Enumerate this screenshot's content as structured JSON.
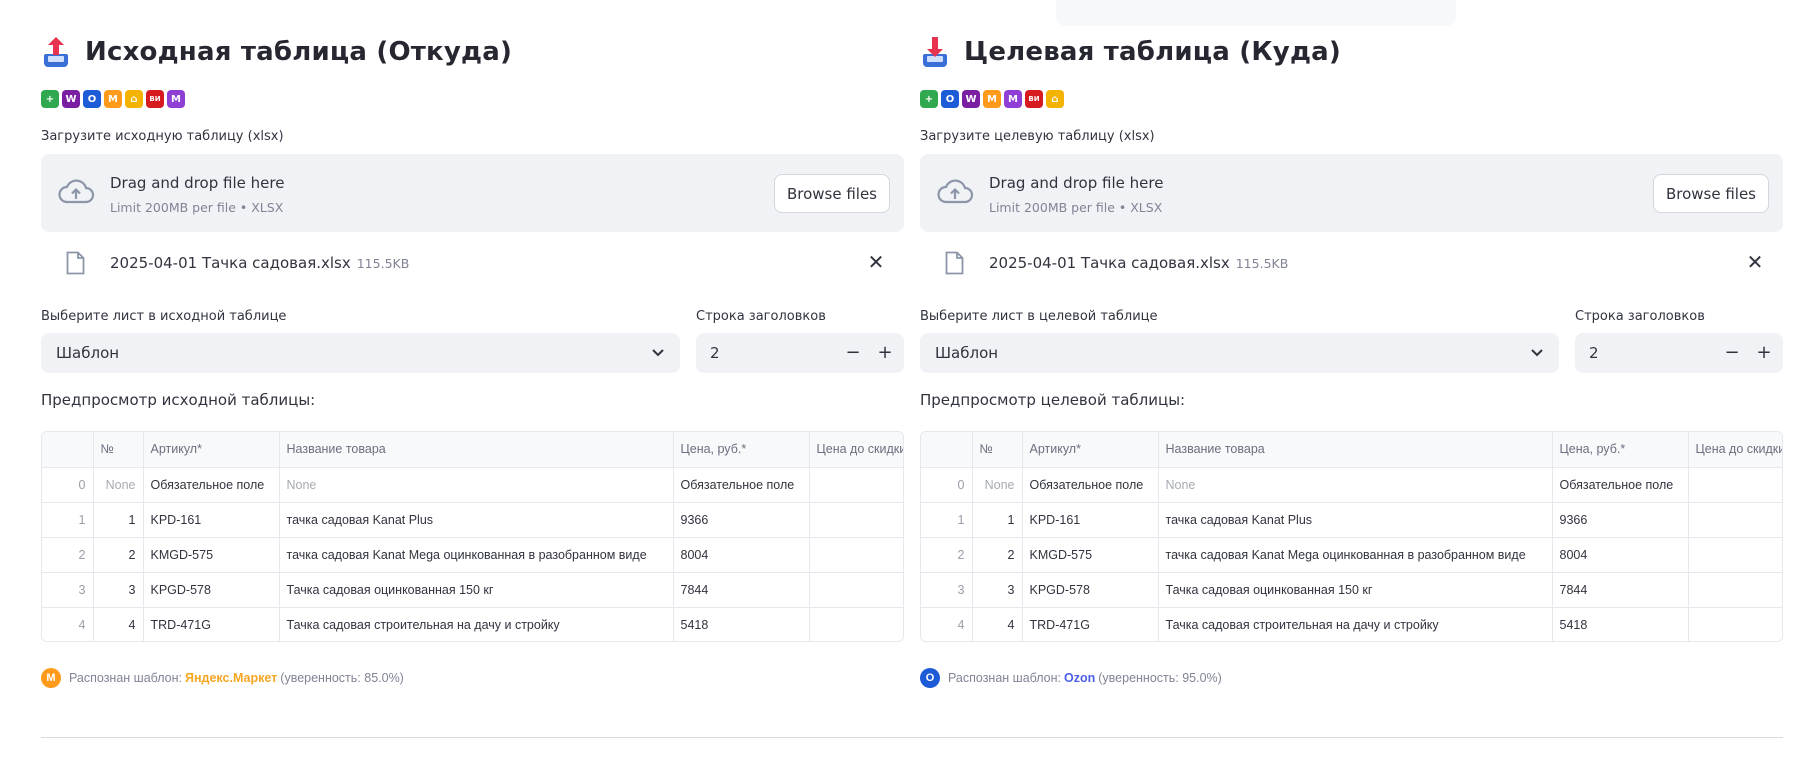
{
  "marketplace_icons_left": [
    {
      "name": "plus-icon",
      "glyph": "+",
      "color": "#2fa84f"
    },
    {
      "name": "wildberries-icon",
      "glyph": "W",
      "color": "#7b1fa2"
    },
    {
      "name": "ozon-icon",
      "glyph": "O",
      "color": "#1e5bd6"
    },
    {
      "name": "yandex-market-icon",
      "glyph": "M",
      "color": "#ff9a1a"
    },
    {
      "name": "home-icon",
      "glyph": "⌂",
      "color": "#f5b301"
    },
    {
      "name": "vi-icon",
      "glyph": "ВИ",
      "color": "#d71920"
    },
    {
      "name": "megamarket-icon",
      "glyph": "M",
      "color": "#8f3fd6"
    }
  ],
  "marketplace_icons_right": [
    {
      "name": "plus-icon",
      "glyph": "+",
      "color": "#2fa84f"
    },
    {
      "name": "ozon-icon",
      "glyph": "O",
      "color": "#1e5bd6"
    },
    {
      "name": "wildberries-icon",
      "glyph": "W",
      "color": "#7b1fa2"
    },
    {
      "name": "yandex-market-icon",
      "glyph": "M",
      "color": "#ff9a1a"
    },
    {
      "name": "megamarket-icon",
      "glyph": "M",
      "color": "#8f3fd6"
    },
    {
      "name": "vi-icon",
      "glyph": "ВИ",
      "color": "#d71920"
    },
    {
      "name": "home-icon",
      "glyph": "⌂",
      "color": "#f5b301"
    }
  ],
  "left": {
    "title": "Исходная таблица (Откуда)",
    "uploader_label": "Загрузите исходную таблицу (xlsx)",
    "drop_text": "Drag and drop file here",
    "limit_text": "Limit 200MB per file • XLSX",
    "browse_label": "Browse files",
    "file_name": "2025-04-01 Тачка садовая.xlsx",
    "file_size": "115.5KB",
    "close_glyph": "✕",
    "sheet_label": "Выберите лист в исходной таблице",
    "sheet_value": "Шаблон",
    "header_row_label": "Строка заголовков",
    "header_row_value": "2",
    "minus_glyph": "−",
    "plus_glyph": "+",
    "preview_label": "Предпросмотр исходной таблицы:",
    "detect_prefix": "Распознан шаблон:",
    "detect_name": "Яндекс.Маркет",
    "detect_suffix": "(уверенность: 85.0%)",
    "detect_color": "#f5a623",
    "detect_icon_color": "#ff9a1a",
    "detect_icon_glyph": "M"
  },
  "right": {
    "title": "Целевая таблица (Куда)",
    "uploader_label": "Загрузите целевую таблицу (xlsx)",
    "drop_text": "Drag and drop file here",
    "limit_text": "Limit 200MB per file • XLSX",
    "browse_label": "Browse files",
    "file_name": "2025-04-01 Тачка садовая.xlsx",
    "file_size": "115.5KB",
    "close_glyph": "✕",
    "sheet_label": "Выберите лист в целевой таблице",
    "sheet_value": "Шаблон",
    "header_row_label": "Строка заголовков",
    "header_row_value": "2",
    "minus_glyph": "−",
    "plus_glyph": "+",
    "preview_label": "Предпросмотр целевой таблицы:",
    "detect_prefix": "Распознан шаблон:",
    "detect_name": "Ozon",
    "detect_suffix": "(уверенность: 95.0%)",
    "detect_color": "#4b5ee8",
    "detect_icon_color": "#1e5bd6",
    "detect_icon_glyph": "O"
  },
  "table": {
    "columns": [
      "",
      "№",
      "Артикул*",
      "Название товара",
      "Цена, руб.*",
      "Цена до скидки"
    ],
    "rows": [
      {
        "idx": "0",
        "n": "None",
        "sku": "Обязательное поле",
        "name": "None",
        "price": "Обязательное поле",
        "old": ""
      },
      {
        "idx": "1",
        "n": "1",
        "sku": "KPD-161",
        "name": "тачка садовая Kanat Plus",
        "price": "9366",
        "old": ""
      },
      {
        "idx": "2",
        "n": "2",
        "sku": "KMGD-575",
        "name": "тачка садовая Kanat Mega оцинкованная в разобранном виде",
        "price": "8004",
        "old": ""
      },
      {
        "idx": "3",
        "n": "3",
        "sku": "KPGD-578",
        "name": "Тачка садовая оцинкованная 150 кг",
        "price": "7844",
        "old": ""
      },
      {
        "idx": "4",
        "n": "4",
        "sku": "TRD-471G",
        "name": "Тачка садовая строительная на дачу и стройку",
        "price": "5418",
        "old": ""
      }
    ]
  }
}
